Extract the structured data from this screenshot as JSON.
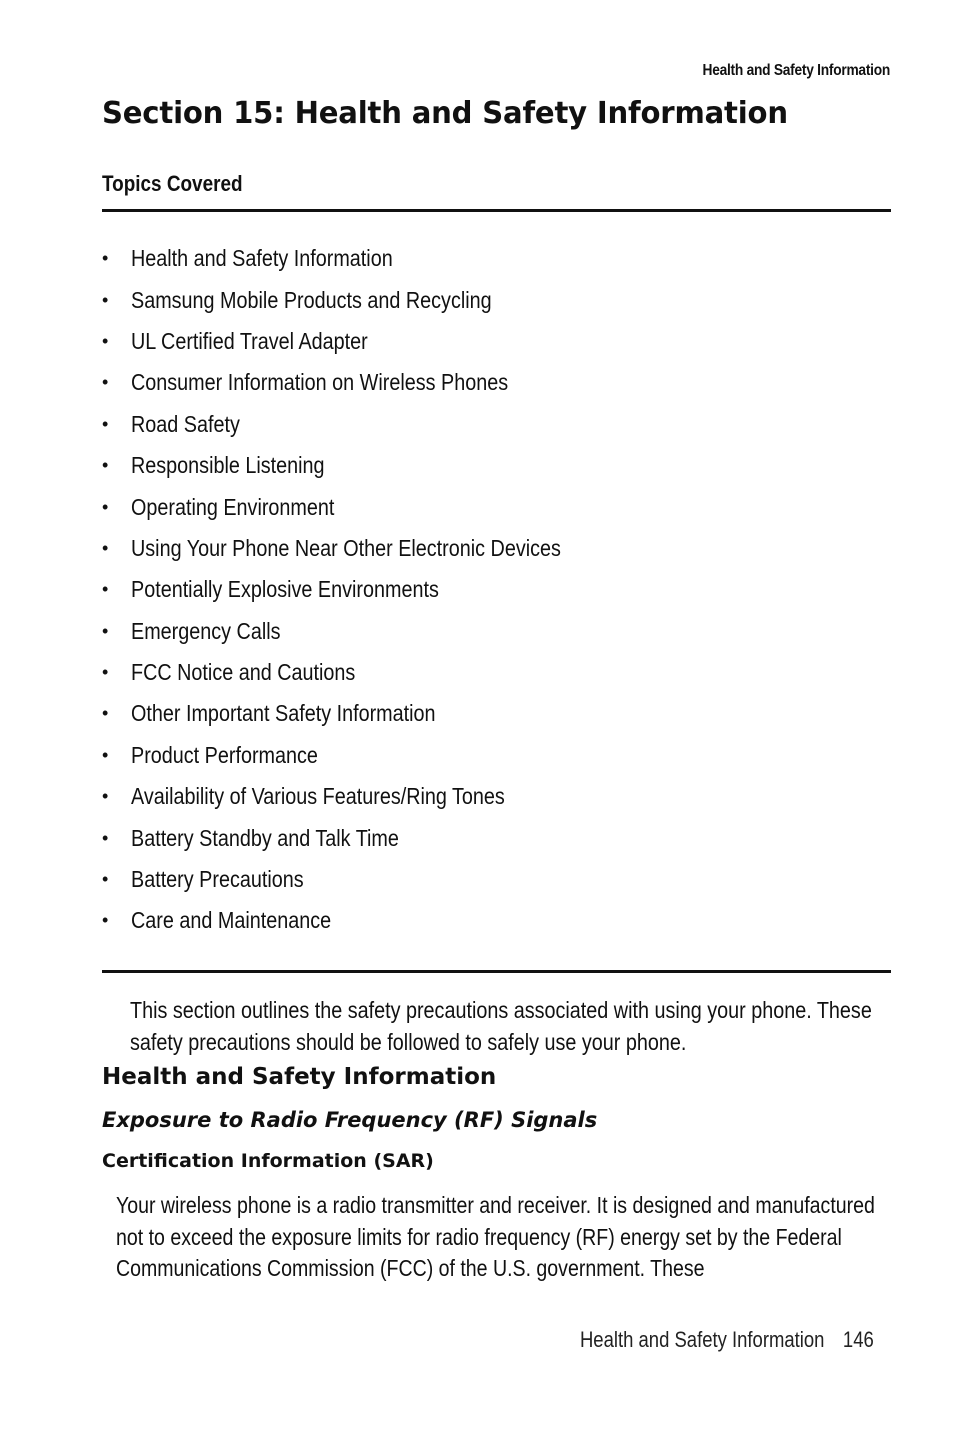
{
  "running_header": "Health and Safety Information",
  "section_title": "Section 15: Health and Safety Information",
  "topics_label": "Topics Covered",
  "topics": [
    "Health and Safety Information",
    "Samsung Mobile Products and Recycling",
    "UL Certified Travel Adapter",
    "Consumer Information on Wireless Phones",
    "Road Safety",
    "Responsible Listening",
    "Operating Environment",
    "Using Your Phone Near Other Electronic Devices",
    "Potentially Explosive Environments",
    "Emergency Calls",
    "FCC Notice and Cautions",
    "Other Important Safety Information",
    "Product Performance",
    "Availability of Various Features/Ring Tones",
    "Battery Standby and Talk Time",
    "Battery Precautions",
    "Care and Maintenance"
  ],
  "bullet_glyph": "•",
  "intro": "This section outlines the safety precautions associated with using your phone. These safety precautions should be followed to safely use your phone.",
  "heading_2": "Health and Safety Information",
  "heading_3": "Exposure to Radio Frequency (RF) Signals",
  "heading_4": "Certification Information (SAR)",
  "body_paragraph": "Your wireless phone is a radio transmitter and receiver. It is designed and manufactured not to exceed the exposure limits for radio frequency (RF) energy set by the Federal Communications Commission (FCC) of the U.S. government. These",
  "footer": {
    "label": "Health and Safety Information",
    "page_number": "146"
  }
}
